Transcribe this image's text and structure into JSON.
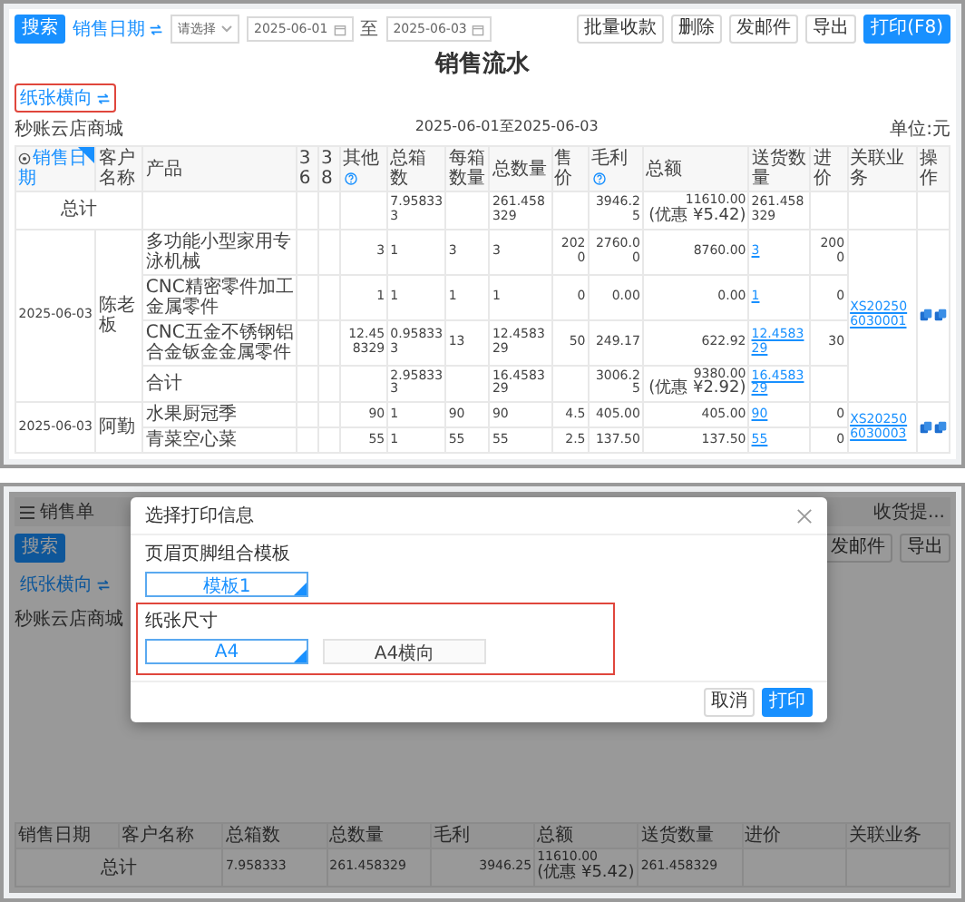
{
  "report": {
    "toolbar": {
      "search_button": "搜索",
      "date_filter": "销售日期",
      "select_placeholder": "请选择",
      "date_from": "2025-06-01",
      "range_separator": "至",
      "date_to": "2025-06-03",
      "actions": [
        {
          "label": "批量收款",
          "primary": false
        },
        {
          "label": "删除",
          "primary": false
        },
        {
          "label": "发邮件",
          "primary": false
        },
        {
          "label": "导出",
          "primary": false
        },
        {
          "label": "打印(F8)",
          "primary": true
        }
      ]
    },
    "title": "销售流水",
    "orientation_toggle": {
      "label": "纸张横向",
      "highlighted": true
    },
    "shop": "秒账云店商城",
    "period": "2025-06-01至2025-06-03",
    "unit": "单位:元",
    "table": {
      "columns": [
        {
          "label": "销售日期",
          "sorted": true,
          "help": false
        },
        {
          "label": "客户名称",
          "sorted": false,
          "help": false
        },
        {
          "label": "产品",
          "sorted": false,
          "help": false
        },
        {
          "label": "36",
          "sorted": false,
          "help": false
        },
        {
          "label": "38",
          "sorted": false,
          "help": false
        },
        {
          "label": "其他",
          "sorted": false,
          "help": true
        },
        {
          "label": "总箱数",
          "sorted": false,
          "help": false
        },
        {
          "label": "每箱数量",
          "sorted": false,
          "help": false
        },
        {
          "label": "总数量",
          "sorted": false,
          "help": false
        },
        {
          "label": "售价",
          "sorted": false,
          "help": false
        },
        {
          "label": "毛利",
          "sorted": false,
          "help": true
        },
        {
          "label": "总额",
          "sorted": false,
          "help": false
        },
        {
          "label": "送货数量",
          "sorted": false,
          "help": false
        },
        {
          "label": "进价",
          "sorted": false,
          "help": false
        },
        {
          "label": "关联业务",
          "sorted": false,
          "help": false
        },
        {
          "label": "操作",
          "sorted": false,
          "help": false
        }
      ],
      "total": {
        "label": "总计",
        "cells": [
          null,
          null,
          null,
          "7.958333",
          null,
          "261.458329",
          null,
          "3946.25",
          {
            "value": "11610.00",
            "note": "(优惠 ¥5.42)"
          },
          "261.458329",
          null
        ]
      },
      "groups": [
        {
          "date": "2025-06-03",
          "customer": "陈老板",
          "link": "XS202506030001",
          "items": [
            {
              "product": "多功能小型家用专泳机械",
              "cells": [
                null,
                null,
                "3",
                "1",
                "3",
                "3",
                "2020",
                "2760.00",
                "8760.00",
                "3",
                "2000"
              ]
            },
            {
              "product": "CNC精密零件加工金属零件",
              "cells": [
                null,
                null,
                "1",
                "1",
                "1",
                "1",
                "0",
                "0.00",
                "0.00",
                "1",
                "0"
              ]
            },
            {
              "product": "CNC五金不锈钢铝合金钣金金属零件",
              "cells": [
                null,
                null,
                "12.458329",
                "0.958333",
                "13",
                "12.458329",
                "50",
                "249.17",
                "622.92",
                "12.458329",
                "30"
              ]
            }
          ],
          "subtotal": {
            "label": "合计",
            "cells": [
              null,
              null,
              null,
              "2.958333",
              null,
              "16.458329",
              null,
              "3006.25",
              {
                "value": "9380.00",
                "note": "(优惠 ¥2.92)"
              },
              "16.458329",
              null
            ]
          }
        },
        {
          "date": "2025-06-03",
          "customer": "阿勤",
          "link": "XS202506030003",
          "items": [
            {
              "product": "水果厨冠季",
              "cells": [
                null,
                null,
                "90",
                "1",
                "90",
                "90",
                "4.5",
                "405.00",
                "405.00",
                "90",
                "0"
              ]
            },
            {
              "product": "青菜空心菜",
              "cells": [
                null,
                null,
                "55",
                "1",
                "55",
                "55",
                "2.5",
                "137.50",
                "137.50",
                "55",
                "0"
              ]
            }
          ]
        }
      ]
    }
  },
  "print_view": {
    "background": {
      "tab": "销售单",
      "right_tab": "收货提...",
      "search_button": "搜索",
      "actions": [
        "发邮件",
        "导出"
      ],
      "orientation_toggle": "纸张横向",
      "shop": "秒账云店商城",
      "columns": [
        "销售日期",
        "客户名称",
        "总箱数",
        "总数量",
        "毛利",
        "总额",
        "送货数量",
        "进价",
        "关联业务"
      ],
      "total": {
        "label": "总计",
        "cells": [
          "7.958333",
          "261.458329",
          "3946.25",
          {
            "value": "11610.00",
            "note": "(优惠 ¥5.42)"
          },
          "261.458329",
          null,
          null
        ]
      }
    },
    "dialog": {
      "title": "选择打印信息",
      "template_label": "页眉页脚组合模板",
      "templates": [
        {
          "label": "模板1",
          "selected": true
        }
      ],
      "paper_label": "纸张尺寸",
      "paper_highlighted": true,
      "papers": [
        {
          "label": "A4",
          "selected": true
        },
        {
          "label": "A4横向",
          "selected": false
        }
      ],
      "buttons": [
        {
          "label": "取消",
          "primary": false
        },
        {
          "label": "打印",
          "primary": true
        }
      ]
    }
  }
}
